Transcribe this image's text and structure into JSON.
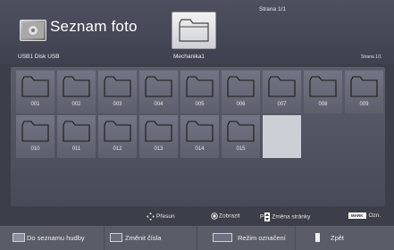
{
  "header": {
    "title": "Seznam foto",
    "page_indicator_top": "Strana 1/1",
    "device_label": "USB1 Disk USB",
    "current_folder": "Mechanika1",
    "page_indicator_right": "Strana 1/1"
  },
  "grid": {
    "row1": [
      "001",
      "002",
      "003",
      "004",
      "005",
      "006",
      "007",
      "008",
      "009"
    ],
    "row2": [
      "010",
      "011",
      "012",
      "013",
      "014",
      "015"
    ]
  },
  "hints": {
    "move": "Přesun",
    "show": "Zobrazit",
    "page_prefix": "P",
    "page_change": "Změna stránky",
    "mark_key": "MARK",
    "mark": "Ozn."
  },
  "buttons": {
    "red": "Do seznamu hudby",
    "green": "Změnit čísla",
    "yellow": "Režim označení",
    "blue": "Zpět"
  },
  "icons": {
    "app": "photo-folder-icon",
    "folder": "folder-icon",
    "move": "four-way-arrows-icon",
    "ok": "ok-circle-icon",
    "page": "page-up-down-icon"
  }
}
